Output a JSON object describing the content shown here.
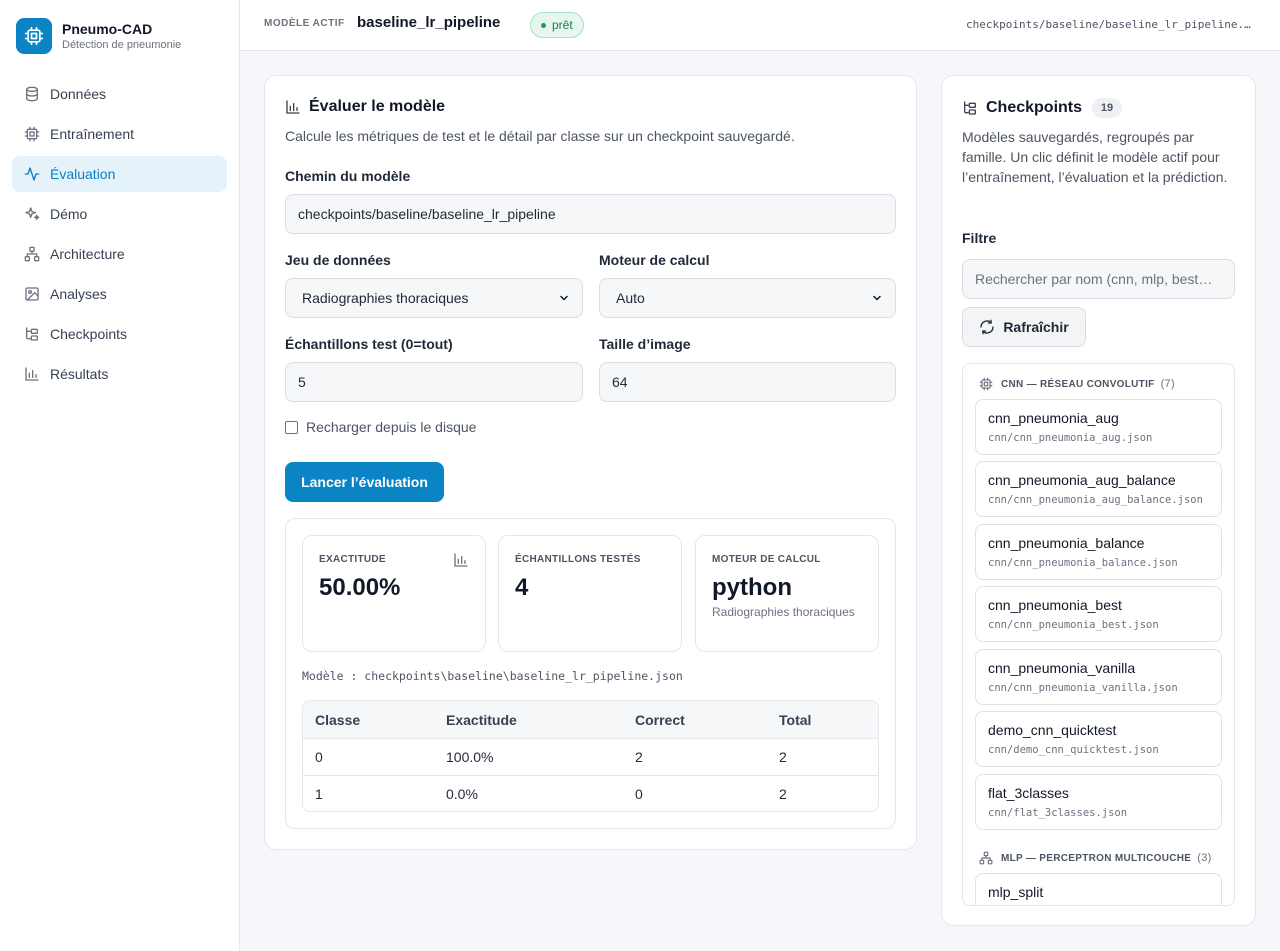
{
  "app": {
    "title": "Pneumo-CAD",
    "subtitle": "Détection de pneumonie"
  },
  "sidebar": {
    "items": [
      {
        "label": "Données",
        "icon": "database-icon"
      },
      {
        "label": "Entraînement",
        "icon": "cpu-icon"
      },
      {
        "label": "Évaluation",
        "icon": "activity-icon",
        "active": true
      },
      {
        "label": "Démo",
        "icon": "sparkles-icon"
      },
      {
        "label": "Architecture",
        "icon": "network-icon"
      },
      {
        "label": "Analyses",
        "icon": "image-chart-icon"
      },
      {
        "label": "Checkpoints",
        "icon": "folder-tree-icon"
      },
      {
        "label": "Résultats",
        "icon": "bar-chart-icon"
      }
    ]
  },
  "header": {
    "label": "MODÈLE ACTIF",
    "model": "baseline_lr_pipeline",
    "status": "prêt",
    "path": "checkpoints/baseline/baseline_lr_pipeline.json"
  },
  "evaluate": {
    "title": "Évaluer le modèle",
    "description": "Calcule les métriques de test et le détail par classe sur un checkpoint sauvegardé.",
    "model_path_label": "Chemin du modèle",
    "model_path_value": "checkpoints/baseline/baseline_lr_pipeline",
    "dataset_label": "Jeu de données",
    "dataset_value": "Radiographies thoraciques",
    "engine_label": "Moteur de calcul",
    "engine_value": "Auto",
    "samples_label": "Échantillons test (0=tout)",
    "samples_value": "5",
    "image_size_label": "Taille d’image",
    "image_size_value": "64",
    "reload_label": "Recharger depuis le disque",
    "run_button": "Lancer l’évaluation"
  },
  "results": {
    "accuracy_label": "EXACTITUDE",
    "accuracy_value": "50.00%",
    "samples_label": "ÉCHANTILLONS TESTÉS",
    "samples_value": "4",
    "engine_label": "MOTEUR DE CALCUL",
    "engine_value": "python",
    "engine_sub": "Radiographies thoraciques",
    "model_line": "Modèle : checkpoints\\baseline\\baseline_lr_pipeline.json",
    "table": {
      "headers": [
        "Classe",
        "Exactitude",
        "Correct",
        "Total"
      ],
      "rows": [
        [
          "0",
          "100.0%",
          "2",
          "2"
        ],
        [
          "1",
          "0.0%",
          "0",
          "2"
        ]
      ]
    }
  },
  "checkpoints": {
    "title": "Checkpoints",
    "count": "19",
    "description": "Modèles sauvegardés, regroupés par famille. Un clic définit le modèle actif pour l’entraînement, l’évaluation et la prédiction.",
    "filter_label": "Filtre",
    "search_placeholder": "Rechercher par nom (cnn, mlp, best…",
    "refresh_button": "Rafraîchir",
    "groups": [
      {
        "name": "CNN — RÉSEAU CONVOLUTIF",
        "count": "(7)",
        "items": [
          {
            "name": "cnn_pneumonia_aug",
            "file": "cnn/cnn_pneumonia_aug.json"
          },
          {
            "name": "cnn_pneumonia_aug_balance",
            "file": "cnn/cnn_pneumonia_aug_balance.json"
          },
          {
            "name": "cnn_pneumonia_balance",
            "file": "cnn/cnn_pneumonia_balance.json"
          },
          {
            "name": "cnn_pneumonia_best",
            "file": "cnn/cnn_pneumonia_best.json"
          },
          {
            "name": "cnn_pneumonia_vanilla",
            "file": "cnn/cnn_pneumonia_vanilla.json"
          },
          {
            "name": "demo_cnn_quicktest",
            "file": "cnn/demo_cnn_quicktest.json"
          },
          {
            "name": "flat_3classes",
            "file": "cnn/flat_3classes.json"
          }
        ]
      },
      {
        "name": "MLP — PERCEPTRON MULTICOUCHE",
        "count": "(3)",
        "items": [
          {
            "name": "mlp_split",
            "file": ""
          }
        ]
      }
    ]
  },
  "colors": {
    "accent": "#0b84c6",
    "success": "#15803d"
  }
}
